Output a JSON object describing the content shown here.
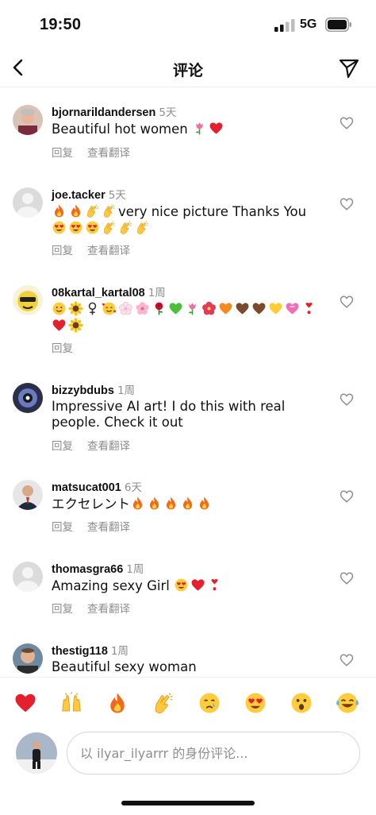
{
  "status_bar": {
    "time": "19:50",
    "network": "5G"
  },
  "nav": {
    "title": "评论"
  },
  "comment_actions": {
    "reply": "回复",
    "translate": "查看翻译"
  },
  "comments": [
    {
      "username": "bjornarildandersen",
      "time": "5天",
      "text": "Beautiful hot women",
      "emojis": [
        "tulip",
        "red-heart"
      ],
      "show_translate": true
    },
    {
      "username": "joe.tacker",
      "time": "5天",
      "text": "very nice picture Thanks You",
      "emojis_before": [
        "fire",
        "fire",
        "clapping-hands",
        "clapping-hands"
      ],
      "emojis_after": [
        "heart-eyes",
        "heart-eyes",
        "heart-eyes",
        "clapping-hands",
        "clapping-hands",
        "clapping-hands"
      ],
      "show_translate": true
    },
    {
      "username": "08kartal_kartal08",
      "time": "1周",
      "text": "",
      "emojis": [
        "smiling-face",
        "sunflower",
        "woman-symbol",
        "smiling-face-hearts",
        "white-flower",
        "cherry-blossom",
        "rose",
        "green-heart",
        "tulip",
        "hibiscus",
        "orange-heart",
        "brown-heart",
        "brown-heart",
        "yellow-heart",
        "pink-heart",
        "exclamation-heart",
        "red-heart",
        "sunflower"
      ],
      "show_translate": false
    },
    {
      "username": "bizzybdubs",
      "time": "1周",
      "text": "Impressive AI art! I do this with real people. Check it out",
      "emojis": [],
      "show_translate": true
    },
    {
      "username": "matsucat001",
      "time": "6天",
      "text": "エクセレント",
      "emojis": [
        "fire",
        "fire",
        "fire",
        "fire",
        "fire"
      ],
      "show_translate": true
    },
    {
      "username": "thomasgra66",
      "time": "1周",
      "text": "Amazing sexy Girl",
      "emojis": [
        "heart-eyes",
        "red-heart",
        "exclamation-heart"
      ],
      "show_translate": true
    },
    {
      "username": "thestig118",
      "time": "1周",
      "text": "Beautiful sexy woman",
      "emojis": [],
      "show_translate": false
    }
  ],
  "quick_reactions": [
    "red-heart",
    "raising-hands",
    "fire",
    "clapping-hands",
    "crying-face",
    "heart-eyes",
    "astonished-face",
    "tears-of-joy"
  ],
  "comment_box": {
    "placeholder": "以 ilyar_ilyarrr 的身份评论..."
  },
  "colors": {
    "secondary_text": "#8e8e8e",
    "divider": "#ececec",
    "heart_red": "#e0245e"
  }
}
